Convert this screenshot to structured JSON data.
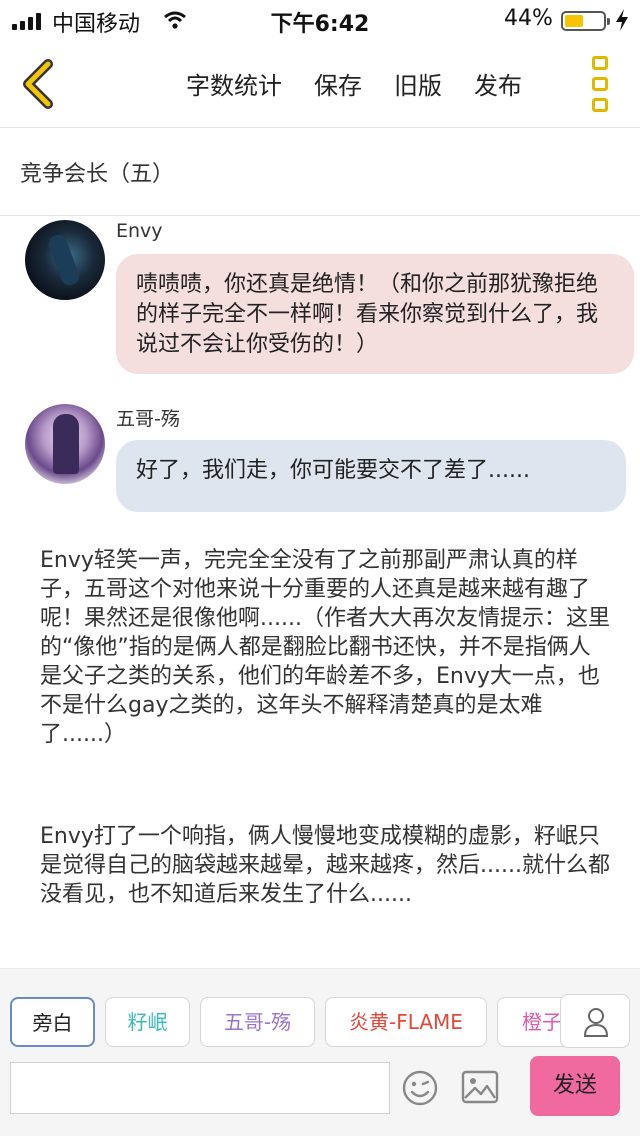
{
  "status_bar": {
    "carrier": "中国移动",
    "time": "下午6:42",
    "battery": "44%",
    "battery_level": 0.44
  },
  "header": {
    "actions": [
      "字数统计",
      "保存",
      "旧版",
      "发布"
    ]
  },
  "chapter_title": "竞争会长（五）",
  "messages": [
    {
      "speaker": "Envy",
      "text": "啧啧啧，你还真是绝情！（和你之前那犹豫拒绝的样子完全不一样啊！看来你察觉到什么了，我说过不会让你受伤的！）"
    },
    {
      "speaker": "五哥-殇",
      "text": "好了，我们走，你可能要交不了差了......"
    }
  ],
  "narration": [
    "Envy轻笑一声，完完全全没有了之前那副严肃认真的样子，五哥这个对他来说十分重要的人还真是越来越有趣了呢！果然还是很像他啊......（作者大大再次友情提示：这里的“像他”指的是俩人都是翻脸比翻书还快，并不是指俩人是父子之类的关系，他们的年龄差不多，Envy大一点，也不是什么gay之类的，这年头不解释清楚真的是太难了......）",
    "Envy打了一个响指，俩人慢慢地变成模糊的虚影，籽岷只是觉得自己的脑袋越来越晕，越来越疼，然后......就什么都没看见，也不知道后来发生了什么......"
  ],
  "roles": [
    {
      "label": "旁白",
      "color": "#222222"
    },
    {
      "label": "籽岷",
      "color": "#3bbcb8"
    },
    {
      "label": "五哥-殇",
      "color": "#9a74c9"
    },
    {
      "label": "炎黄-FLAME",
      "color": "#e0493a"
    },
    {
      "label": "橙子",
      "color": "#e05aa8"
    }
  ],
  "input": {
    "value": "",
    "placeholder": ""
  },
  "send_label": "发送",
  "colors": {
    "accent_yellow": "#e0b800",
    "send_pink": "#f06aa0",
    "envy_bubble": "#f4dede",
    "wuge_bubble": "#dfe5ee"
  }
}
